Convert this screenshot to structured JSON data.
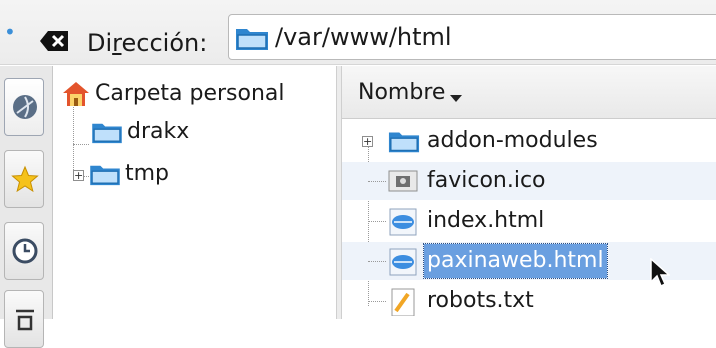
{
  "location_bar": {
    "label_prefix": "Di",
    "label_accel": "r",
    "label_suffix": "ección:",
    "path": "/var/www/html",
    "icons": [
      "toolbar-grip-icon",
      "clear-location-icon",
      "folder-icon"
    ]
  },
  "side_tabs": [
    {
      "icon": "network-icon"
    },
    {
      "icon": "bookmarks-star-icon"
    },
    {
      "icon": "history-clock-icon"
    },
    {
      "icon": "more-tab-icon"
    }
  ],
  "tree": {
    "items": [
      {
        "label": "Carpeta personal",
        "icon": "home-folder-icon"
      },
      {
        "label": "drakx",
        "icon": "folder-icon"
      },
      {
        "label": "tmp",
        "icon": "folder-icon",
        "expander": "+"
      }
    ]
  },
  "file_list": {
    "column_header": "Nombre",
    "sort_icon": "sort-descending-icon",
    "rows": [
      {
        "name": "addon-modules",
        "icon": "folder-icon",
        "expander": "+"
      },
      {
        "name": "favicon.ico",
        "icon": "image-file-icon"
      },
      {
        "name": "index.html",
        "icon": "html-file-icon"
      },
      {
        "name": "paxinaweb.html",
        "icon": "html-file-icon",
        "selected": true
      },
      {
        "name": "robots.txt",
        "icon": "text-file-icon"
      }
    ]
  },
  "colors": {
    "selection": "#6a9fe0",
    "folder": "#4aa3e6",
    "home_roof": "#e3542c",
    "alt_row": "#eef3fa"
  }
}
